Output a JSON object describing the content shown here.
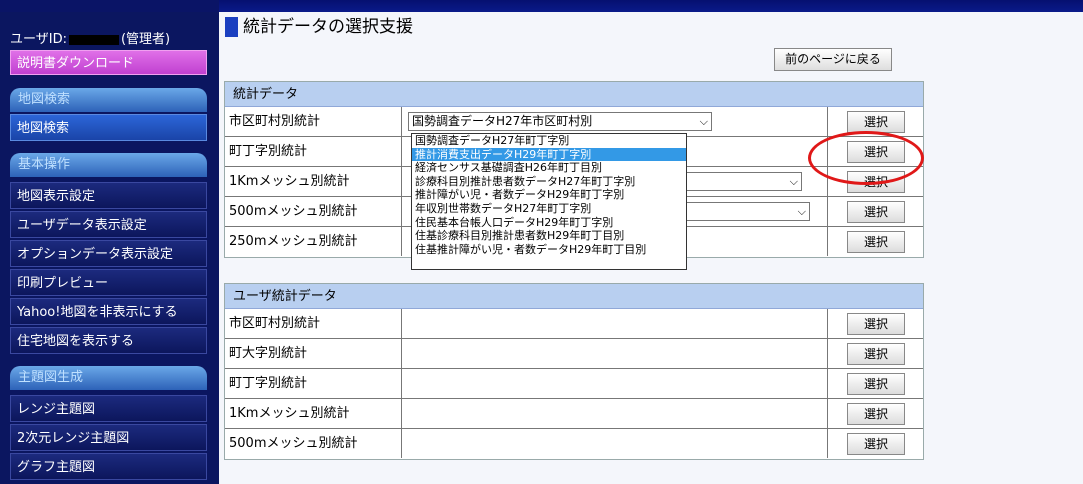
{
  "sidebar": {
    "user_label": "ユーザID:",
    "role": "(管理者)",
    "manual_download": "説明書ダウンロード",
    "sections": [
      {
        "title": "地図検索",
        "items": [
          "地図検索"
        ]
      },
      {
        "title": "基本操作",
        "items": [
          "地図表示設定",
          "ユーザデータ表示設定",
          "オプションデータ表示設定",
          "印刷プレビュー",
          "Yahoo!地図を非表示にする",
          "住宅地図を表示する"
        ]
      },
      {
        "title": "主題図生成",
        "items": [
          "レンジ主題図",
          "2次元レンジ主題図",
          "グラフ主題図"
        ]
      }
    ]
  },
  "page": {
    "title": "統計データの選択支援",
    "back_button": "前のページに戻る",
    "select_button": "選択"
  },
  "stats_panel": {
    "header": "統計データ",
    "rows": [
      {
        "label": "市区町村別統計",
        "select_value": "国勢調査データH27年市区町村別"
      },
      {
        "label": "町丁字別統計",
        "select_value": ""
      },
      {
        "label": "1Kmメッシュ別統計",
        "select_value": ""
      },
      {
        "label": "500mメッシュ別統計",
        "select_value": ""
      },
      {
        "label": "250mメッシュ別統計",
        "select_value": ""
      }
    ]
  },
  "dropdown_options": [
    "国勢調査データH27年町丁字別",
    "推計消費支出データH29年町丁字別",
    "経済センサス基礎調査H26年町丁目別",
    "診療科目別推計患者数データH27年町丁字別",
    "推計障がい児・者数データH29年町丁字別",
    "年収別世帯数データH27年町丁字別",
    "住民基本台帳人口データH29年町丁字別",
    "住基診療科目別推計患者数H29年町丁目別",
    "住基推計障がい児・者数データH29年町丁目別"
  ],
  "dropdown_selected_index": 1,
  "user_panel": {
    "header": "ユーザ統計データ",
    "rows": [
      "市区町村別統計",
      "町大字別統計",
      "町丁字別統計",
      "1Kmメッシュ別統計",
      "500mメッシュ別統計"
    ]
  },
  "colors": {
    "highlight": "#e01818",
    "selected_option": "#3399e6"
  }
}
